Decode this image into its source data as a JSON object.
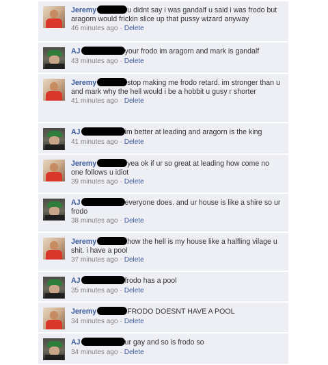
{
  "comments": [
    {
      "author": "Jeremy",
      "text": "u didnt say i was gandalf u said i was frodo but aragorn would frickin slice up that pussy wizard anyway",
      "time": "46 minutes ago",
      "delete": "Delete",
      "avatar": "jeremy"
    },
    {
      "author": "AJ",
      "text": "your frodo im aragorn and mark is gandalf",
      "time": "43 minutes ago",
      "delete": "Delete",
      "avatar": "aj"
    },
    {
      "author": "Jeremy",
      "text": "stop making me frodo retard. im stronger than u and mark why the hell would i be a hobbit u gusy r shorter",
      "time": "41 minutes ago",
      "delete": "Delete",
      "avatar": "jeremy"
    },
    {
      "author": "AJ",
      "text": "im better at leading and aragorn is the king",
      "time": "41 minutes ago",
      "delete": "Delete",
      "avatar": "aj"
    },
    {
      "author": "Jeremy",
      "text": "yea ok if ur so great at leading how come no one follows u idiot",
      "time": "39 minutes ago",
      "delete": "Delete",
      "avatar": "jeremy"
    },
    {
      "author": "AJ",
      "text": "everyone does. and ur house is like a shire so ur frodo",
      "time": "38 minutes ago",
      "delete": "Delete",
      "avatar": "aj"
    },
    {
      "author": "Jeremy",
      "text": "how the hell is my house like a halfling vilage u shit. i have a pool",
      "time": "37 minutes ago",
      "delete": "Delete",
      "avatar": "jeremy"
    },
    {
      "author": "AJ",
      "text": "frodo has a pool",
      "time": "35 minutes ago",
      "delete": "Delete",
      "avatar": "aj"
    },
    {
      "author": "Jeremy",
      "text": "FRODO DOESNT HAVE A POOL",
      "time": "34 minutes ago",
      "delete": "Delete",
      "avatar": "jeremy"
    },
    {
      "author": "AJ",
      "text": "ur gay and so is frodo so",
      "time": "34 minutes ago",
      "delete": "Delete",
      "avatar": "aj"
    }
  ],
  "meta_separator": "·"
}
